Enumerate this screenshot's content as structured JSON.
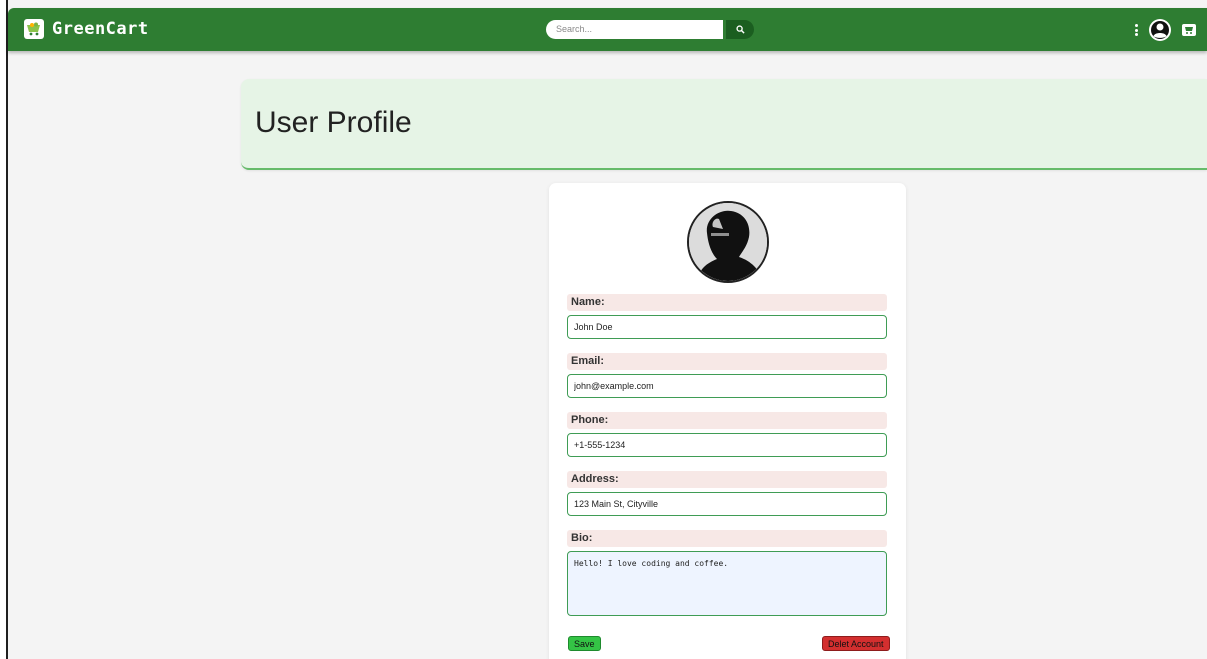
{
  "colors": {
    "navbar": "#2e7d32",
    "header_bg": "#e6f4e6",
    "label_bg": "#f7e8e6",
    "input_border": "#3f9c55",
    "save": "#34c445",
    "delete": "#d32f2f"
  },
  "navbar": {
    "brand_name": "GreenCart",
    "brand_icon": "cart-logo-icon",
    "search_placeholder": "Search...",
    "search_icon": "search-icon",
    "icons": [
      "more-vertical-icon",
      "user-account-icon",
      "cart-icon"
    ]
  },
  "header": {
    "title": "User Profile"
  },
  "profile": {
    "avatar_icon": "avatar-silhouette",
    "fields": [
      {
        "label": "Name:",
        "value": "John Doe"
      },
      {
        "label": "Email:",
        "value": "john@example.com"
      },
      {
        "label": "Phone:",
        "value": "+1-555-1234"
      },
      {
        "label": "Address:",
        "value": "123 Main St, Cityville"
      }
    ],
    "bio": {
      "label": "Bio:",
      "value": "Hello! I love coding and coffee."
    },
    "save_label": "Save",
    "delete_label": "Delet Account"
  }
}
